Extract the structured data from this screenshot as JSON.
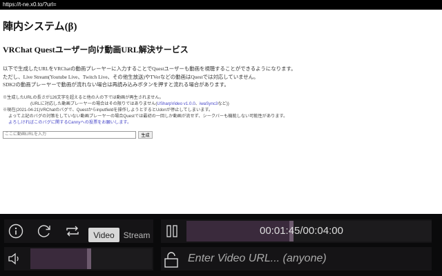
{
  "browser": {
    "url": "https://t-ne.x0.to/?url="
  },
  "page": {
    "title": "陣内システム",
    "title_suffix": "(β)",
    "subtitle": "VRChat Questユーザー向け動画URL解決サービス",
    "paragraphs": [
      "以下で生成したURLをVRChatの動画プレーヤーに入力することでQuestユーザーも動画を視聴することができるようになります。",
      "ただし、Live Stream(Youtube Live、Twitch Live、その他生放送)やTVerなどの動画はQuestでは対応していません。",
      "SDK2の動画プレーヤーで動画が流れない場合は再読み込みボタンを押すと流れる場合があります。"
    ],
    "notes": {
      "n1": "※生成したURLの長さが126文字を超えると他の人の下では動画が再生されません。",
      "n2_pre": "(URLに対応した動画プレーヤーの場合はその限りではありません(",
      "n2_link1": "USharpVideo v1.0.0",
      "n2_sep": "、",
      "n2_link2": "iwaSync3",
      "n2_post": "など))",
      "n3": "※現在(2021-04-21)VRChatのバグで、Questからinputfieldを操作しようとするとUdonが停止してしまいます。",
      "n4": "よって上記のバグの対策をしていない動画プレーヤーの場合Questでは最初の一回しか動画が流せず、シークバーも機能しない可能性があります。",
      "n5_link": "よろしければこのバグに関するCannyへの投票をお願いします。"
    },
    "form": {
      "placeholder": "ここに動画URLを入力",
      "button": "生成"
    }
  },
  "player": {
    "mode_video": "Video",
    "mode_stream": "Stream",
    "active_mode": "Video",
    "time": "00:01:45/00:04:00",
    "progress": 0.4375,
    "volume": 0.5,
    "url_placeholder": "Enter Video URL... (anyone)",
    "colors": {
      "bg": "#0a0a0b",
      "panel": "#151416",
      "fill": "#3a2a3c",
      "handle": "#6d5a6e"
    }
  }
}
